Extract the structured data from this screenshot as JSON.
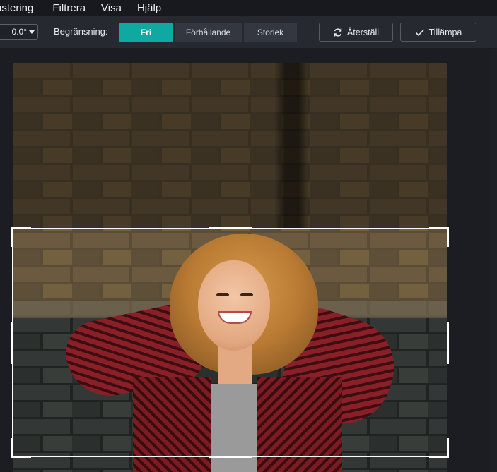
{
  "menubar": {
    "items": [
      {
        "label": "ustering"
      },
      {
        "label": "Filtrera"
      },
      {
        "label": "Visa"
      },
      {
        "label": "Hjälp"
      }
    ]
  },
  "toolbar": {
    "angle_value": "0.0°",
    "limit_label": "Begränsning:",
    "segments": [
      {
        "label": "Fri",
        "active": true
      },
      {
        "label": "Förhållande",
        "active": false
      },
      {
        "label": "Storlek",
        "active": false
      }
    ],
    "reset_label": "Återställ",
    "apply_label": "Tillämpa"
  },
  "colors": {
    "accent": "#0fa9a2",
    "toolbar_bg": "#262930",
    "workspace_bg": "#1b1d23"
  }
}
